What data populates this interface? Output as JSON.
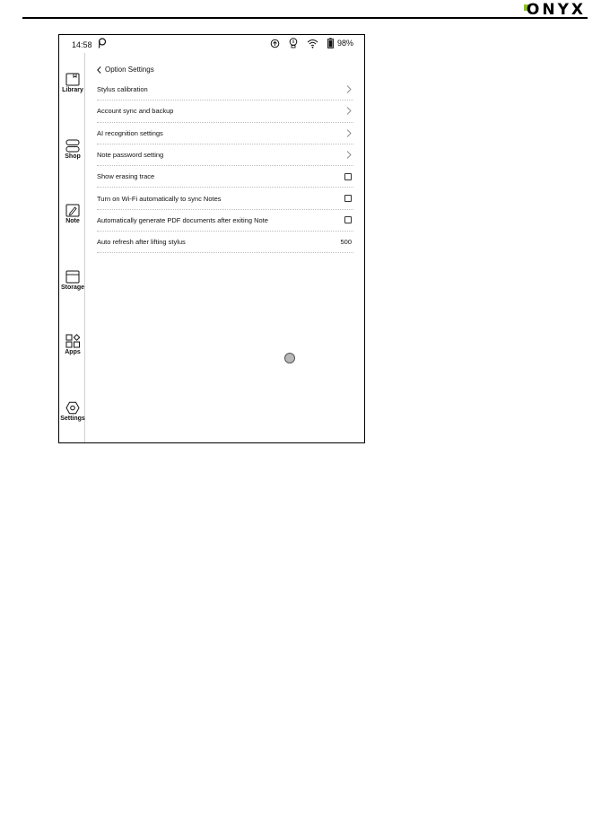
{
  "header": {
    "brand": "ONYX",
    "brand_accent": "#8dc21f"
  },
  "statusbar": {
    "time": "14:58",
    "battery": "98%",
    "icons": [
      "pen-app-icon",
      "sync-icon",
      "bulb-icon",
      "wifi-icon",
      "battery-icon"
    ]
  },
  "sidebar": {
    "items": [
      {
        "label": "Library",
        "icon": "library-icon"
      },
      {
        "label": "Shop",
        "icon": "shop-icon"
      },
      {
        "label": "Note",
        "icon": "note-icon"
      },
      {
        "label": "Storage",
        "icon": "storage-icon"
      },
      {
        "label": "Apps",
        "icon": "apps-icon"
      },
      {
        "label": "Settings",
        "icon": "settings-icon"
      }
    ]
  },
  "page": {
    "back_label": "Option Settings"
  },
  "settings": [
    {
      "label": "Stylus calibration",
      "control": "chevron"
    },
    {
      "label": "Account sync and backup",
      "control": "chevron"
    },
    {
      "label": "AI recognition settings",
      "control": "chevron"
    },
    {
      "label": "Note password setting",
      "control": "chevron"
    },
    {
      "label": "Show erasing trace",
      "control": "checkbox",
      "checked": false
    },
    {
      "label": "Turn on Wi-Fi automatically to sync Notes",
      "control": "checkbox",
      "checked": false
    },
    {
      "label": "Automatically generate PDF documents after exiting Note",
      "control": "checkbox",
      "checked": false
    },
    {
      "label": "Auto refresh after lifting stylus",
      "control": "value",
      "value": "500"
    }
  ]
}
